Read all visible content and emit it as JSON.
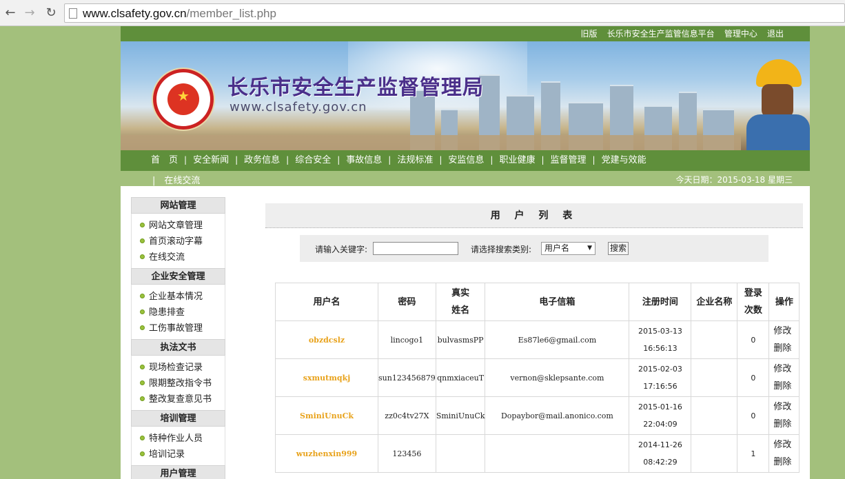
{
  "browser": {
    "url_domain": "www.clsafety.gov.cn",
    "url_path": "/member_list.php"
  },
  "topbar": {
    "links": [
      "旧版",
      "长乐市安全生产监管信息平台",
      "管理中心",
      "退出"
    ]
  },
  "banner": {
    "title": "长乐市安全生产监督管理局",
    "url": "www.clsafety.gov.cn",
    "seal_text": "www.clsafety.gov.cn"
  },
  "nav": {
    "items": [
      "首　页",
      "安全新闻",
      "政务信息",
      "综合安全",
      "事故信息",
      "法规标准",
      "安监信息",
      "职业健康",
      "监督管理",
      "党建与效能"
    ],
    "more": "|　在线交流",
    "date": "今天日期：2015-03-18 星期三"
  },
  "sidebar": {
    "sections": [
      {
        "title": "网站管理",
        "items": [
          "网站文章管理",
          "首页滚动字幕",
          "在线交流"
        ]
      },
      {
        "title": "企业安全管理",
        "items": [
          "企业基本情况",
          "隐患排查",
          "工伤事故管理"
        ]
      },
      {
        "title": "执法文书",
        "items": [
          "现场检查记录",
          "限期整改指令书",
          "整改复查意见书"
        ]
      },
      {
        "title": "培训管理",
        "items": [
          "特种作业人员",
          "培训记录"
        ]
      },
      {
        "title": "用户管理",
        "items": []
      }
    ]
  },
  "main": {
    "title": "用 户 列 表",
    "search": {
      "keyword_label": "请输入关键字:",
      "keyword_value": "",
      "category_label": "请选择搜索类别:",
      "category_value": "用户名",
      "button": "搜索"
    },
    "table": {
      "headers": [
        "用户名",
        "密码",
        "真实姓名",
        "电子信箱",
        "注册时间",
        "企业名称",
        "登录次数",
        "操作"
      ],
      "rows": [
        {
          "user": "obzdcslz",
          "pwd": "lincogo1",
          "real": "bulvasmsPP",
          "email": "Es87le6@gmail.com",
          "date": "2015-03-13",
          "time": "16:56:13",
          "company": "",
          "count": "0",
          "edit": "修改",
          "del": "删除"
        },
        {
          "user": "sxmutmqkj",
          "pwd": "sun123456879",
          "real": "qnmxiaceuT",
          "email": "vernon@sklepsante.com",
          "date": "2015-02-03",
          "time": "17:16:56",
          "company": "",
          "count": "0",
          "edit": "修改",
          "del": "删除"
        },
        {
          "user": "SminiUnuCk",
          "pwd": "zz0c4tv27X",
          "real": "SminiUnuCk",
          "email": "Dopaybor@mail.anonico.com",
          "date": "2015-01-16",
          "time": "22:04:09",
          "company": "",
          "count": "0",
          "edit": "修改",
          "del": "删除"
        },
        {
          "user": "wuzhenxin999",
          "pwd": "123456",
          "real": "",
          "email": "",
          "date": "2014-11-26",
          "time": "08:42:29",
          "company": "",
          "count": "1",
          "edit": "修改",
          "del": "删除"
        }
      ]
    }
  }
}
